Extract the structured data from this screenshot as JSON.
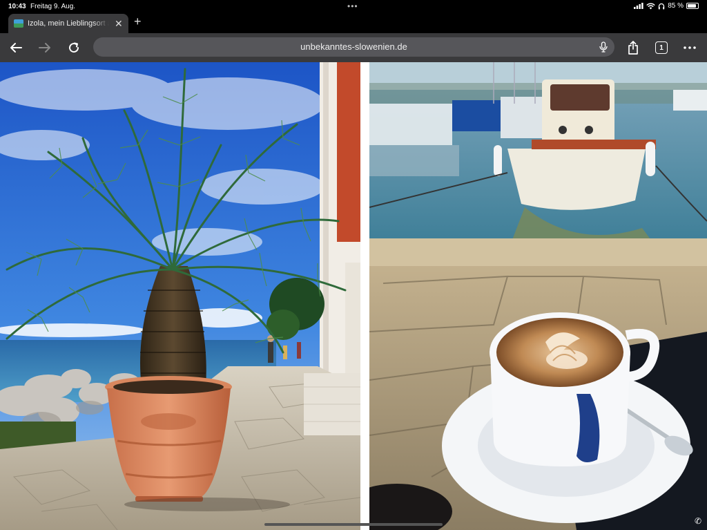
{
  "status": {
    "time": "10:43",
    "date": "Freitag 9. Aug.",
    "battery_percent": "85 %",
    "battery_level": 0.85,
    "icons": [
      "cellular-icon",
      "wifi-icon",
      "headphones-icon",
      "battery-icon"
    ]
  },
  "tab": {
    "title": "Izola, mein Lieblingsort an der Küste",
    "favicon": "slovenia-favicon"
  },
  "toolbar": {
    "url": "unbekanntes-slowenien.de",
    "tab_count": "1"
  },
  "content": {
    "photos": [
      "palm-in-terracotta-pot-by-sea",
      "cappuccino-at-harbor-with-boat"
    ]
  },
  "colors": {
    "chrome_bg": "#3a3a3c",
    "address_bg": "#56565a"
  }
}
